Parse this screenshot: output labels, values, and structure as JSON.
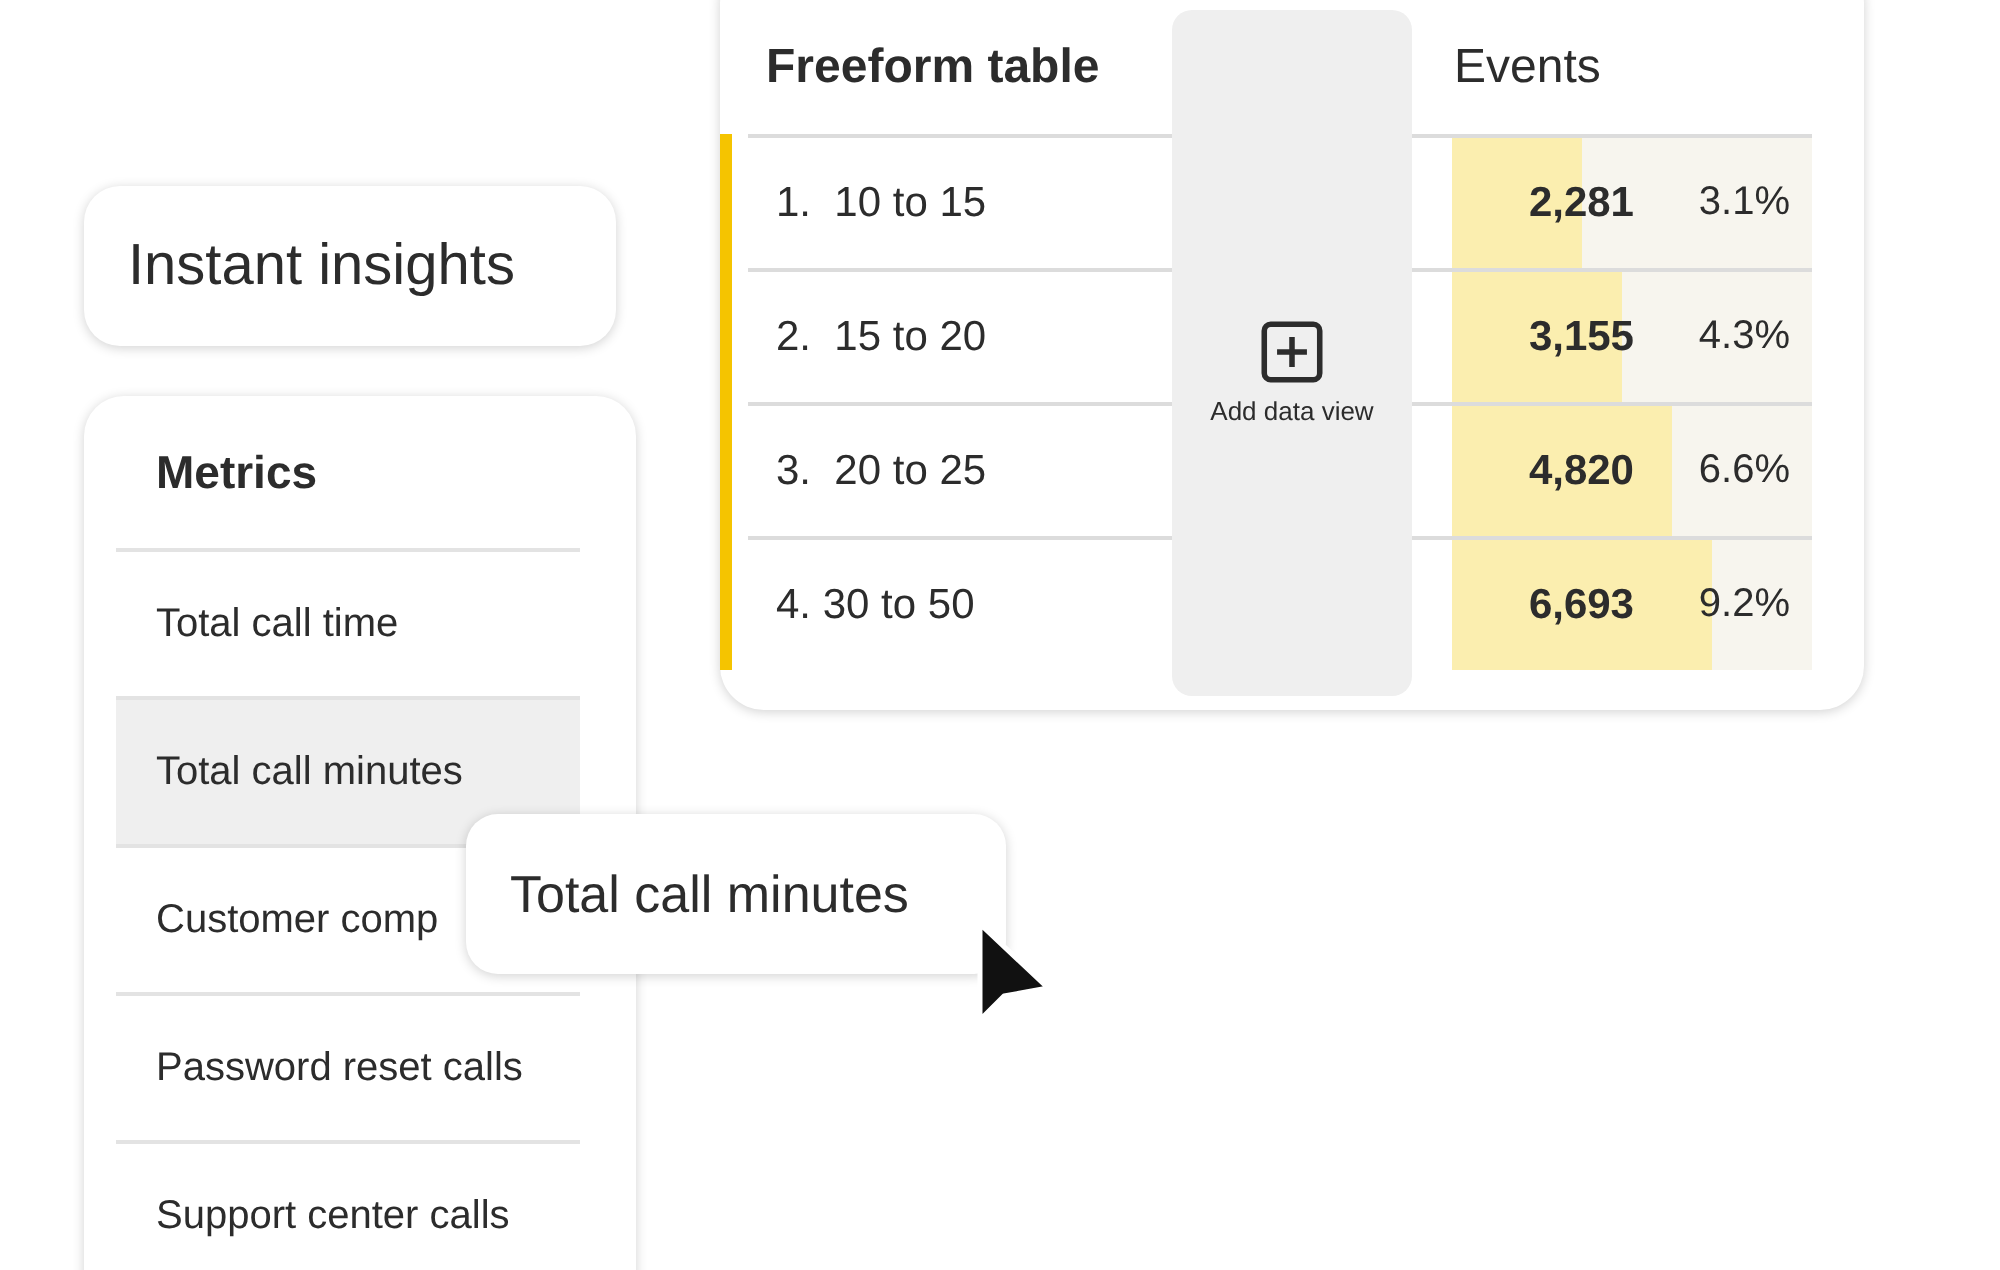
{
  "insights_button": {
    "label": "Instant insights"
  },
  "metrics_panel": {
    "title": "Metrics",
    "items": [
      {
        "label": "Total call time",
        "selected": false
      },
      {
        "label": "Total call minutes",
        "selected": true
      },
      {
        "label": "Customer comp",
        "selected": false
      },
      {
        "label": "Password reset calls",
        "selected": false
      },
      {
        "label": "Support center calls",
        "selected": false
      }
    ]
  },
  "drag_tooltip": {
    "label": "Total call minutes"
  },
  "freeform_table": {
    "title": "Freeform table",
    "add_data_view": "Add data view",
    "metric_column": "Events",
    "rows": [
      {
        "label": "1.  10 to 15",
        "value": "2,281",
        "percent": "3.1%",
        "level": 0.36
      },
      {
        "label": "2.  15 to 20",
        "value": "3,155",
        "percent": "4.3%",
        "level": 0.47
      },
      {
        "label": "3.  20 to 25",
        "value": "4,820",
        "percent": "6.6%",
        "level": 0.61
      },
      {
        "label": "4. 30 to 50",
        "value": "6,693",
        "percent": "9.2%",
        "level": 0.72
      }
    ]
  }
}
